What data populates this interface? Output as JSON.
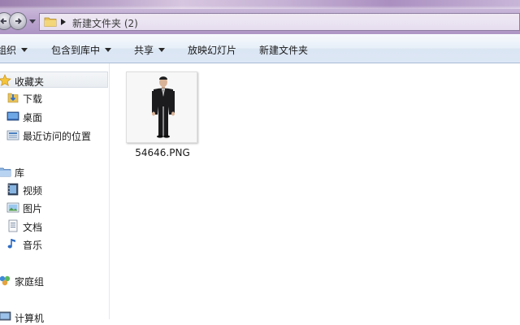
{
  "address": {
    "path": "新建文件夹 (2)"
  },
  "toolbar": {
    "organize": "组织",
    "include_in_library": "包含到库中",
    "share": "共享",
    "slideshow": "放映幻灯片",
    "new_folder": "新建文件夹"
  },
  "nav": {
    "favorites": "收藏夹",
    "downloads": "下载",
    "desktop": "桌面",
    "recent": "最近访问的位置",
    "libraries": "库",
    "videos": "视频",
    "pictures": "图片",
    "documents": "文档",
    "music": "音乐",
    "homegroup": "家庭组",
    "computer": "计算机"
  },
  "files": [
    {
      "name": "54646.PNG",
      "icon": "person-photo-thumbnail"
    }
  ],
  "colors": {
    "aero": "#b9a3c9",
    "toolbar_top": "#f7fafd",
    "toolbar_bottom": "#dce7f5",
    "selection": "#e9edf1"
  }
}
